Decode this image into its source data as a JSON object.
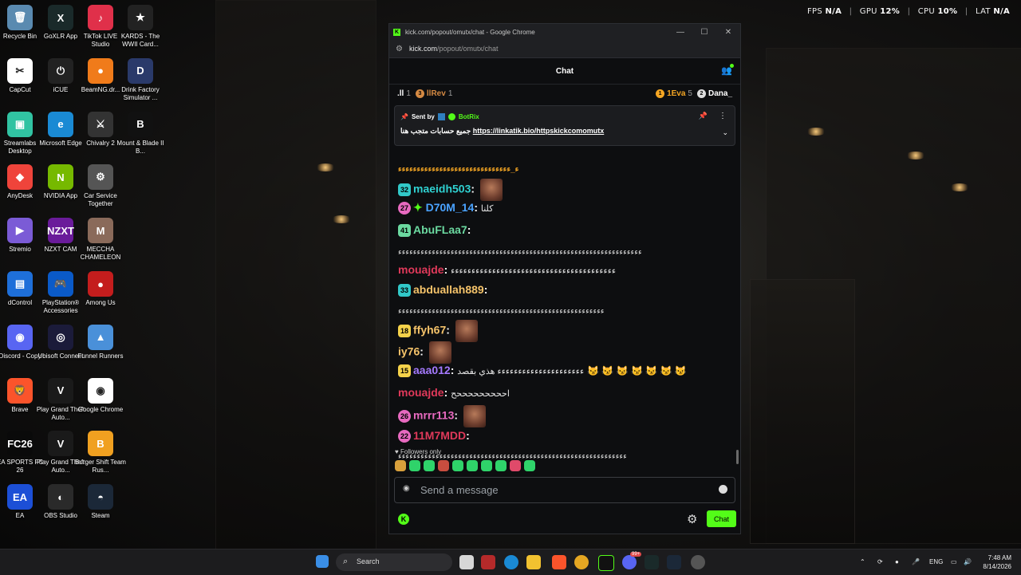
{
  "perf": {
    "fps_label": "FPS",
    "fps_value": "N/A",
    "gpu_label": "GPU",
    "gpu_value": "12",
    "cpu_label": "CPU",
    "cpu_value": "10",
    "lat_label": "LAT",
    "lat_value": "N/A",
    "unit": "%",
    "separator": "|"
  },
  "desktop_icons": [
    {
      "label": "Recycle Bin",
      "color": "#5a8ab0",
      "glyph": "🗑"
    },
    {
      "label": "GoXLR App",
      "color": "#1a2a2a",
      "glyph": "X"
    },
    {
      "label": "TikTok LIVE Studio",
      "color": "#e0304a",
      "glyph": "♪"
    },
    {
      "label": "KARDS - The WWII Card...",
      "color": "#222222",
      "glyph": "★"
    },
    {
      "label": "CapCut",
      "color": "#ffffff",
      "glyph": "✂"
    },
    {
      "label": "iCUE",
      "color": "#222222",
      "glyph": "⏻"
    },
    {
      "label": "BeamNG.dr...",
      "color": "#f07b1a",
      "glyph": "●"
    },
    {
      "label": "Drink Factory Simulator ...",
      "color": "#2a3a6a",
      "glyph": "D"
    },
    {
      "label": "Streamlabs Desktop",
      "color": "#31c3a2",
      "glyph": "▣"
    },
    {
      "label": "Microsoft Edge",
      "color": "#1a8ad4",
      "glyph": "e"
    },
    {
      "label": "Chivalry 2",
      "color": "#333333",
      "glyph": "⚔"
    },
    {
      "label": "Mount & Blade II B...",
      "color": "#111111",
      "glyph": "B"
    },
    {
      "label": "AnyDesk",
      "color": "#ef443b",
      "glyph": "◆"
    },
    {
      "label": "NVIDIA App",
      "color": "#76b900",
      "glyph": "N"
    },
    {
      "label": "Car Service Together",
      "color": "#555555",
      "glyph": "⚙"
    },
    {
      "label": "Stremio",
      "color": "#7b5bd6",
      "glyph": "▶"
    },
    {
      "label": "NZXT CAM",
      "color": "#6a1b9a",
      "glyph": "NZXT"
    },
    {
      "label": "MECCHA CHAMELEON",
      "color": "#8a6a5a",
      "glyph": "M"
    },
    {
      "label": "dControl",
      "color": "#1e6fd9",
      "glyph": "▤"
    },
    {
      "label": "PlayStation® Accessories",
      "color": "#0a5ac8",
      "glyph": "🎮"
    },
    {
      "label": "Among Us",
      "color": "#c41d1d",
      "glyph": "●"
    },
    {
      "label": "Discord - Copy",
      "color": "#5865f2",
      "glyph": "◉"
    },
    {
      "label": "Ubisoft Connect",
      "color": "#1b1b3a",
      "glyph": "◎"
    },
    {
      "label": "Funnel Runners",
      "color": "#4a90d9",
      "glyph": "▲"
    },
    {
      "label": "Brave",
      "color": "#fb542b",
      "glyph": "🦁"
    },
    {
      "label": "Play Grand Theft Auto...",
      "color": "#1a1a1a",
      "glyph": "V"
    },
    {
      "label": "Google Chrome",
      "color": "#ffffff",
      "glyph": "◉"
    },
    {
      "label": "EA SPORTS FC 26",
      "color": "#0a0a0a",
      "glyph": "FC26"
    },
    {
      "label": "Play Grand Theft Auto...",
      "color": "#1a1a1a",
      "glyph": "V"
    },
    {
      "label": "Burger Shift Team Rus...",
      "color": "#f0a020",
      "glyph": "B"
    },
    {
      "label": "EA",
      "color": "#1c4fd6",
      "glyph": "EA"
    },
    {
      "label": "OBS Studio",
      "color": "#2a2a2a",
      "glyph": "◐"
    },
    {
      "label": "Steam",
      "color": "#1b2838",
      "glyph": "◓"
    }
  ],
  "browser": {
    "title": "kick.com/popout/omutx/chat - Google Chrome",
    "address_host": "kick.com",
    "address_path": "/popout/omutx/chat",
    "minimize": "—",
    "maximize": "☐",
    "close": "✕"
  },
  "chat": {
    "header_title": "Chat",
    "gifters": [
      {
        "rank": ".ll",
        "count": "1",
        "color": "#aaaaaa",
        "icon": "bars"
      },
      {
        "rank": "llRev",
        "count": "1",
        "color": "#d58a43",
        "icon": "3"
      },
      {
        "rank": "1Eva",
        "count": "5",
        "color": "#f5a623",
        "icon": "1"
      },
      {
        "rank": "Dana_",
        "count": "",
        "color": "#dddddd",
        "icon": "2"
      }
    ],
    "pinned": {
      "sent_by_label": "Sent by",
      "sender": "BotRix",
      "message_rtl": "جميع حسابات متجب هنا",
      "link": "https://linkatik.bio/httpskickcomomutx"
    },
    "messages": [
      {
        "badge": "",
        "badge_color": "",
        "user": "",
        "user_color": "#f5a623",
        "text": "ء_ءءءءءءءءءءءءءءءءءءءءءءءءءءءءءء",
        "partial": true
      },
      {
        "badge": "32",
        "badge_color": "#31c8c8",
        "user": "maeidh503",
        "user_color": "#2fd1d1",
        "text": "",
        "emote": true
      },
      {
        "badge": "27",
        "badge_color": "#e86ac0",
        "user": "D70M_14",
        "user_color": "#4aa3ff",
        "text": "كلنا",
        "spark": true
      },
      {
        "badge": "41",
        "badge_color": "#6bd9a0",
        "user": "AbuFLaa7",
        "user_color": "#6bd9a0",
        "text": ""
      },
      {
        "badge": "",
        "badge_color": "",
        "user": "",
        "user_color": "#ffffff",
        "text": "ءءءءءءءءءءءءءءءءءءءءءءءءءءءءءءءءءءءءءءءءءءءءءءءءءءءءءءءءءءءءءءءءء"
      },
      {
        "badge": "",
        "badge_color": "",
        "user": "mouajde",
        "user_color": "#e0395a",
        "text": "ءءءءءءءءءءءءءءءءءءءءءءءءءءءءءءءءءءءءءءءء"
      },
      {
        "badge": "33",
        "badge_color": "#31c8c8",
        "user": "abduallah889",
        "user_color": "#f5c36a",
        "text": ""
      },
      {
        "badge": "",
        "badge_color": "",
        "user": "",
        "user_color": "#ffffff",
        "text": "ءءءءءءءءءءءءءءءءءءءءءءءءءءءءءءءءءءءءءءءءءءءءءءءءءءءءءءء"
      },
      {
        "badge": "18",
        "badge_color": "#f5d24a",
        "user": "ffyh67",
        "user_color": "#f5c36a",
        "text": "",
        "emote": true
      },
      {
        "badge": "",
        "badge_color": "",
        "user": "iy76",
        "user_color": "#f5c36a",
        "text": "",
        "emote": true
      },
      {
        "badge": "15",
        "badge_color": "#f5d24a",
        "user": "aaa012",
        "user_color": "#a57aff",
        "text": "ءءءءءءءءءءءءءءءءءءءءء هذي بقصد",
        "cats": "😼 😼 😼 😼 😼 😼 😼"
      },
      {
        "badge": "",
        "badge_color": "",
        "user": "mouajde",
        "user_color": "#e0395a",
        "text": "احححححححححح"
      },
      {
        "badge": "26",
        "badge_color": "#e86ac0",
        "user": "mrrr113",
        "user_color": "#e86ac0",
        "text": "",
        "emote": true
      },
      {
        "badge": "22",
        "badge_color": "#e86ac0",
        "user": "11M7MDD",
        "user_color": "#e0395a",
        "text": ""
      },
      {
        "badge": "",
        "badge_color": "",
        "user": "",
        "user_color": "#ffffff",
        "text": "ءءءءءءءءءءءءءءءءءءءءءءءءءءءءءءءءءءءءءءءءءءءءءءءءءءءءءءءءءءءءء"
      }
    ],
    "followers_only": "Followers only",
    "input_placeholder": "Send a message",
    "send_label": "Chat"
  },
  "taskbar": {
    "search_placeholder": "Search",
    "language": "ENG",
    "time": "7:48 AM",
    "date": "8/14/2026",
    "discord_badge": "99+"
  }
}
